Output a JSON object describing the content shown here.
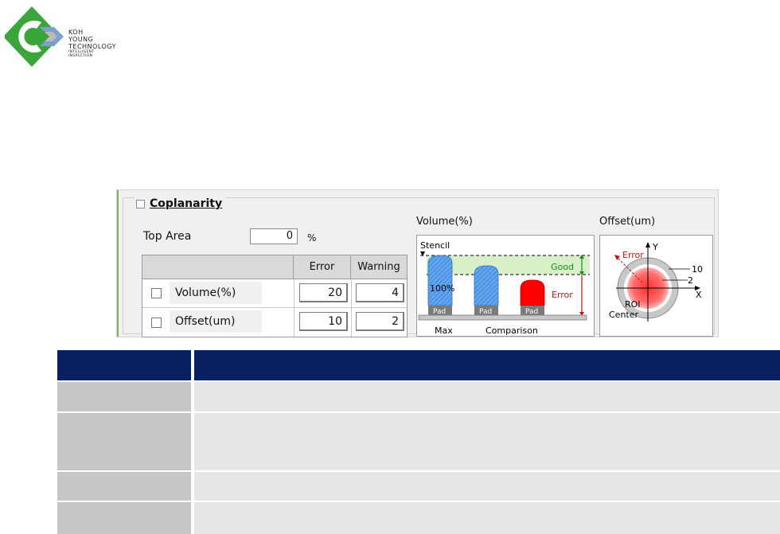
{
  "logo": {
    "lines": [
      "Koh",
      "Young",
      "Technology"
    ],
    "tagline": [
      "Intelligent",
      "Inspection"
    ],
    "colors": {
      "green": "#3aa63a",
      "blue": "#7aa0cc",
      "grey": "#b9b9b9"
    }
  },
  "panel": {
    "title": "Coplanarity",
    "top_area": {
      "label": "Top Area",
      "value": "0",
      "unit": "%"
    },
    "grid": {
      "headers": [
        "",
        "Error",
        "Warning"
      ],
      "rows": [
        {
          "name": "Volume(%)",
          "error": "20",
          "warning": "4"
        },
        {
          "name": "Offset(um)",
          "error": "10",
          "warning": "2"
        }
      ]
    },
    "volume_figure": {
      "title": "Volume(%)",
      "stencil": "Stencil",
      "good": "Good",
      "error": "Error",
      "percent": "100%",
      "pad": "Pad",
      "max": "Max",
      "comparison": "Comparison",
      "colors": {
        "blue": "#4e97e6",
        "red": "#ff0000",
        "good_zone": "#d7f0c8",
        "pad": "#7a7a7a"
      }
    },
    "offset_figure": {
      "title": "Offset(um)",
      "error": "Error",
      "y_axis": "Y",
      "x_axis": "X",
      "outer_value": "10",
      "inner_value": "2",
      "roi": "ROI",
      "center": "Center"
    }
  },
  "table": {
    "header_color": "#082062"
  }
}
